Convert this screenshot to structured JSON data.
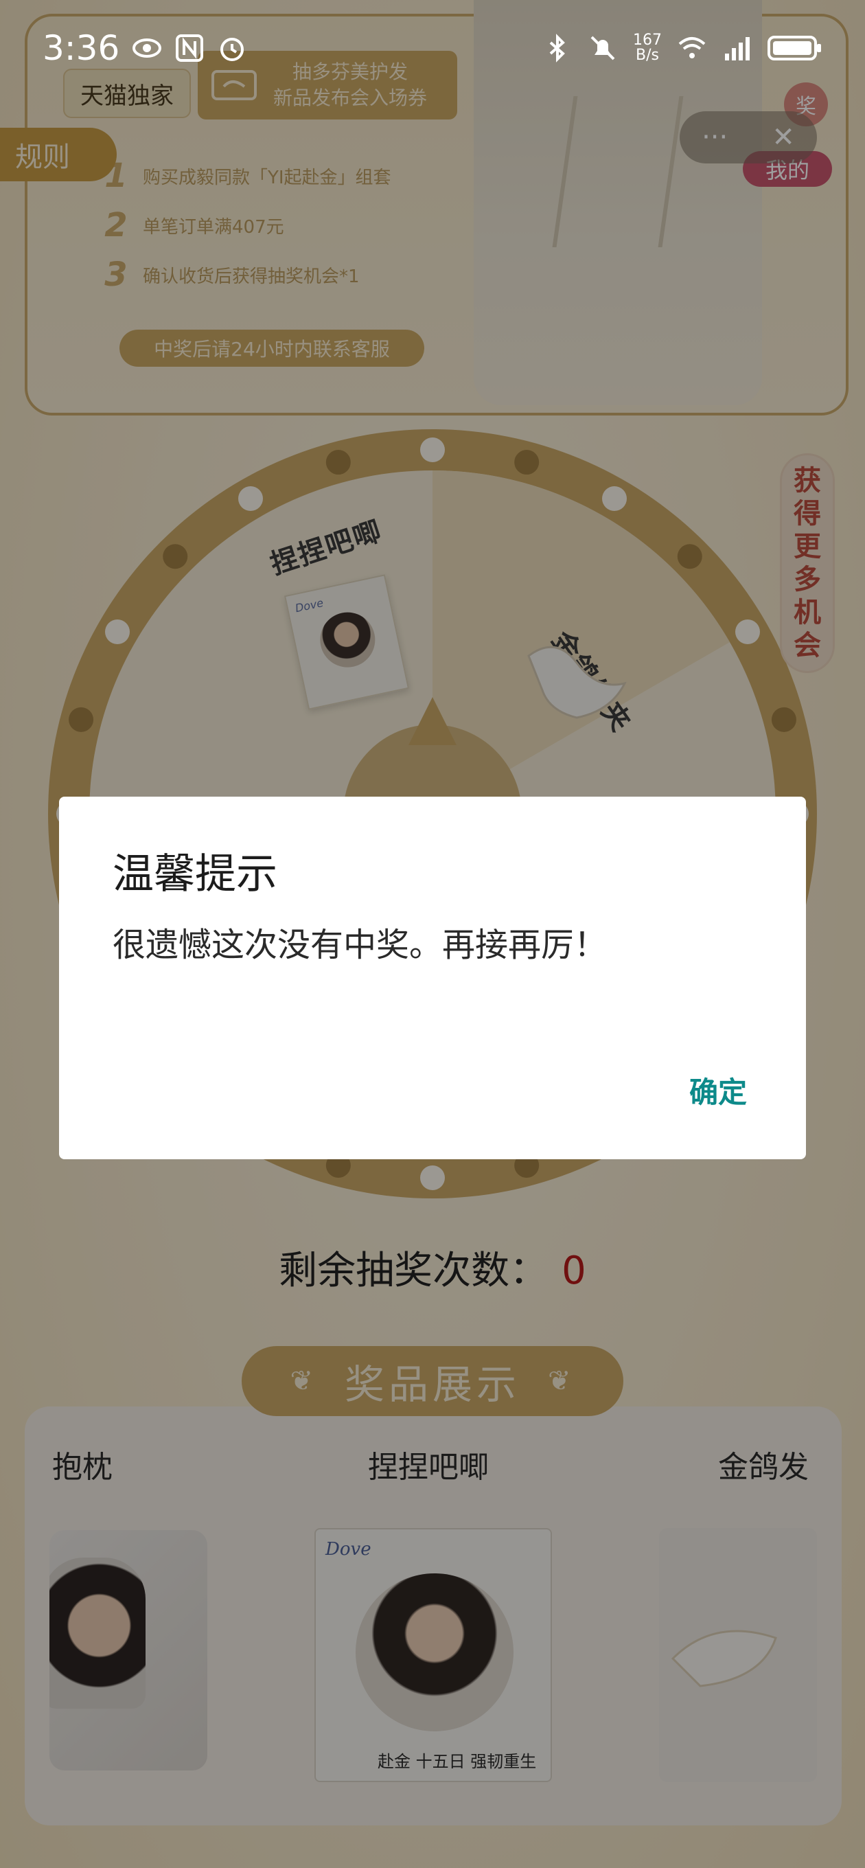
{
  "status_bar": {
    "time": "3:36",
    "net_speed_value": "167",
    "net_speed_unit": "B/s"
  },
  "banner": {
    "tmall_label": "天猫独家",
    "ticket_line1": "抽多芬美护发",
    "ticket_line2": "新品发布会入场券",
    "rules_tab": "规则",
    "rules": [
      {
        "num": "1",
        "text": "购买成毅同款「YI起赴金」组套"
      },
      {
        "num": "2",
        "text": "单笔订单满407元"
      },
      {
        "num": "3",
        "text": "确认收货后获得抽奖机会*1"
      }
    ],
    "contact_note": "中奖后请24小时内联系客服"
  },
  "capsule": {
    "more": "···",
    "close": "✕"
  },
  "prize_corner": {
    "badge": "奖",
    "label": "我的"
  },
  "side_tab": {
    "label": "获得更多机会"
  },
  "wheel": {
    "segments": [
      "捏捏吧唧",
      "金鸽发夹"
    ]
  },
  "remaining": {
    "label": "剩余抽奖次数：",
    "count": "0"
  },
  "prize_display": {
    "title": "奖品展示",
    "items": [
      {
        "label": "抱枕"
      },
      {
        "label": "捏捏吧唧",
        "brand": "Dove",
        "tagline": "赴金 十五日 强韧重生"
      },
      {
        "label": "金鸽发"
      }
    ]
  },
  "dialog": {
    "title": "温馨提示",
    "message": "很遗憾这次没有中奖。再接再厉！",
    "ok_label": "确定"
  },
  "colors": {
    "accent_gold": "#c9a667",
    "dialog_button": "#0d8a8a",
    "count_red": "#b51a1a"
  }
}
